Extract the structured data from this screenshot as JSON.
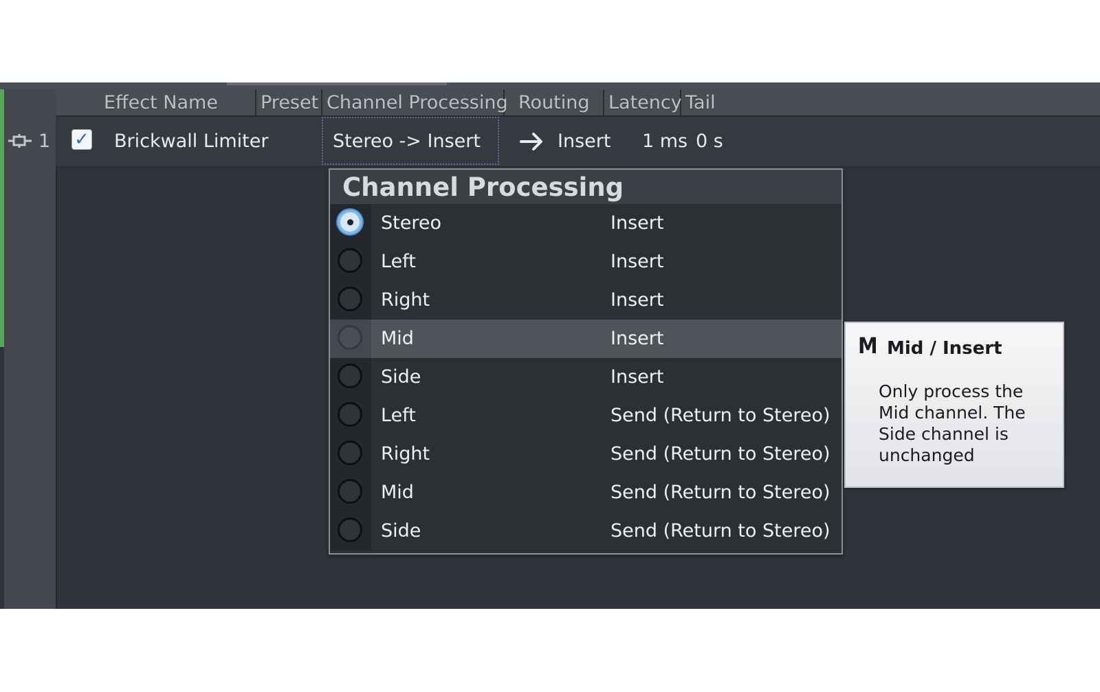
{
  "table": {
    "headers": {
      "effect_name": "Effect Name",
      "preset": "Preset",
      "channel_processing": "Channel Processing",
      "routing": "Routing",
      "latency": "Latency",
      "tail": "Tail"
    },
    "row": {
      "index": "1",
      "enabled": true,
      "effect_name": "Brickwall Limiter",
      "preset": "",
      "channel_processing": "Stereo -> Insert",
      "routing": "Insert",
      "latency": "1 ms",
      "tail": "0 s"
    }
  },
  "popup": {
    "title": "Channel Processing",
    "options": [
      {
        "name": "Stereo",
        "route": "Insert",
        "selected": true
      },
      {
        "name": "Left",
        "route": "Insert"
      },
      {
        "name": "Right",
        "route": "Insert"
      },
      {
        "name": "Mid",
        "route": "Insert",
        "highlighted": true
      },
      {
        "name": "Side",
        "route": "Insert"
      },
      {
        "name": "Left",
        "route": "Send (Return to Stereo)"
      },
      {
        "name": "Right",
        "route": "Send (Return to Stereo)"
      },
      {
        "name": "Mid",
        "route": "Send (Return to Stereo)"
      },
      {
        "name": "Side",
        "route": "Send (Return to Stereo)"
      }
    ]
  },
  "tooltip": {
    "icon": "M",
    "title": "Mid / Insert",
    "body": "Only process the Mid channel. The Side channel is unchanged"
  },
  "colors": {
    "panel_bg": "#30343a",
    "header_bg": "#494d53",
    "selected_radio": "#7fb8ea",
    "highlight_row": "#4f545b",
    "accent_green": "#55a85a"
  },
  "icons": {
    "plugin": "plug-icon",
    "checkbox": "checkmark-icon",
    "routing": "arrow-right-icon",
    "radio": "radio-icon"
  }
}
